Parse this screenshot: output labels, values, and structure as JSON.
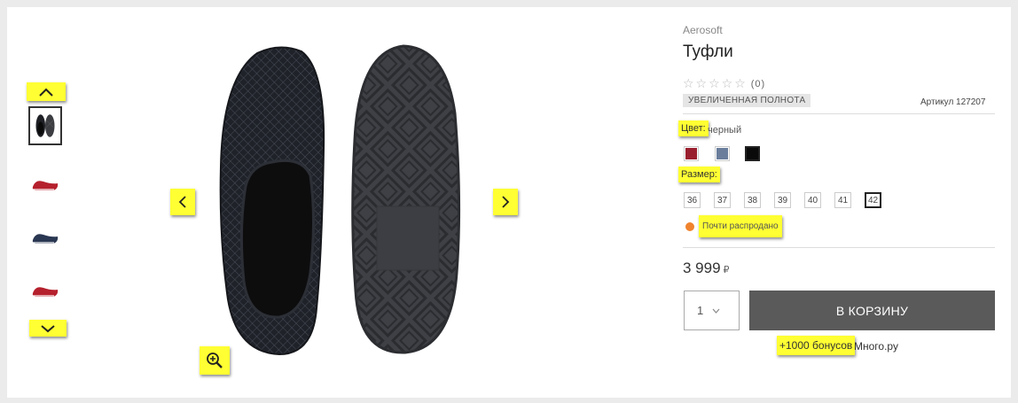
{
  "product": {
    "brand": "Aerosoft",
    "title": "Туфли",
    "rating_stars": "☆☆☆☆☆",
    "rating_count": "(0)",
    "badge": "УВЕЛИЧЕННАЯ ПОЛНОТА",
    "article": "Артикул 127207"
  },
  "color": {
    "label": "Цвет:",
    "value": "черный",
    "swatches": [
      "#9a1f2e",
      "#6a7e9c",
      "#0a0a0a"
    ]
  },
  "size": {
    "label": "Размер:",
    "options": [
      "36",
      "37",
      "38",
      "39",
      "40",
      "41",
      "42"
    ]
  },
  "stock": {
    "text": "Почти распродано",
    "dot_color": "#f0832d"
  },
  "price": {
    "amount": "3 999",
    "currency": "₽"
  },
  "cart": {
    "quantity": "1",
    "button_label": "В КОРЗИНУ"
  },
  "bonus": {
    "text": "+1000 бонусов",
    "suffix": "Много.ру"
  },
  "icons": {
    "thumbs_up": "chevron-up-icon",
    "thumbs_down": "chevron-down-icon",
    "prev": "chevron-left-icon",
    "next": "chevron-right-icon",
    "zoom": "zoom-in-icon",
    "qty_dropdown": "chevron-down-icon"
  },
  "colors": {
    "highlight": "#ffff33",
    "cart_button": "#5a5a5a",
    "background": "#ebebeb"
  }
}
